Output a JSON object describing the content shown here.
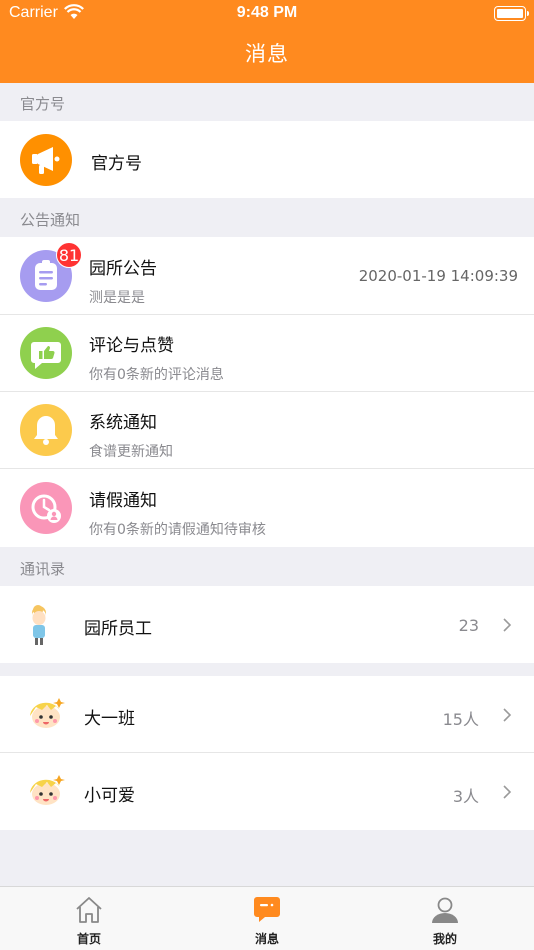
{
  "status_bar": {
    "carrier": "Carrier",
    "time": "9:48 PM"
  },
  "nav": {
    "title": "消息"
  },
  "sections": {
    "official": "官方号",
    "notices": "公告通知",
    "contacts": "通讯录"
  },
  "official_item": {
    "title": "官方号"
  },
  "notice_items": [
    {
      "title": "园所公告",
      "subtitle": "测是是是",
      "time": "2020-01-19 14:09:39",
      "badge": "81"
    },
    {
      "title": "评论与点赞",
      "subtitle": "你有0条新的评论消息"
    },
    {
      "title": "系统通知",
      "subtitle": "食谱更新通知"
    },
    {
      "title": "请假通知",
      "subtitle": "你有0条新的请假通知待审核"
    }
  ],
  "contact_items": [
    {
      "title": "园所员工",
      "count": "23"
    },
    {
      "title": "大一班",
      "count": "15人"
    },
    {
      "title": "小可爱",
      "count": "3人"
    }
  ],
  "tabbar": {
    "items": [
      {
        "label": "首页",
        "icon": "home-icon"
      },
      {
        "label": "消息",
        "icon": "message-icon"
      },
      {
        "label": "我的",
        "icon": "profile-icon"
      }
    ],
    "active_index": 1
  },
  "colors": {
    "accent": "#ff8a1f",
    "badge": "#ff3333",
    "background": "#efeff4"
  }
}
